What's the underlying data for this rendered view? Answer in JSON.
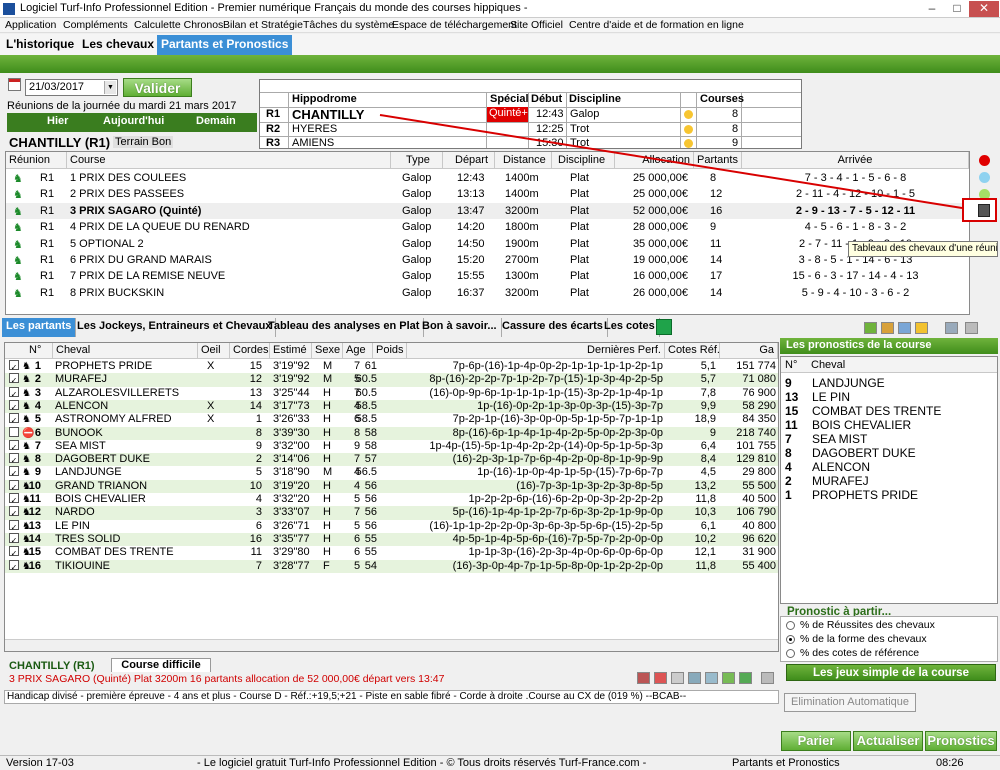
{
  "window": {
    "title": "Logiciel Turf-Info Professionnel Edition - Premier numérique Français du monde des courses hippiques -",
    "controls": [
      "–",
      "□",
      "✕"
    ]
  },
  "menu": [
    "Application",
    "Compléments",
    "Calculette Chronos",
    "Bilan et Stratégie",
    "Tâches du système",
    "Espace de téléchargement",
    "Site Officiel",
    "Centre d'aide et de formation en ligne"
  ],
  "tabs": [
    "L'historique",
    "Les chevaux",
    "Partants et Pronostics"
  ],
  "date": {
    "value": "21/03/2017",
    "valider": "Valider",
    "reunions_label": "Réunions de la journée du mardi 21 mars 2017",
    "nav": [
      "Hier",
      "Aujourd'hui",
      "Demain"
    ]
  },
  "course_header": {
    "title": "CHANTILLY (R1)",
    "terrain": "Terrain Bon"
  },
  "hippodromes": {
    "headers": [
      "Hippodrome",
      "Spécial",
      "Début",
      "Discipline",
      "Courses"
    ],
    "rows": [
      {
        "r": "R1",
        "name": "CHANTILLY",
        "special": "Quinté+",
        "debut": "12:43",
        "discipline": "Galop",
        "courses": "8"
      },
      {
        "r": "R2",
        "name": "HYERES",
        "special": "",
        "debut": "12:25",
        "discipline": "Trot",
        "courses": "8"
      },
      {
        "r": "R3",
        "name": "AMIENS",
        "special": "",
        "debut": "15:30",
        "discipline": "Trot",
        "courses": "9"
      }
    ]
  },
  "races": {
    "headers": [
      "Réunion",
      "Course",
      "Type",
      "Départ",
      "Distance",
      "Discipline",
      "Allocation",
      "Partants",
      "Arrivée"
    ],
    "rows": [
      {
        "r": "R1",
        "course": "1 PRIX DES COULEES",
        "type": "Galop",
        "depart": "12:43",
        "distance": "1400m",
        "discipline": "Plat",
        "allocation": "25 000,00€",
        "partants": "8",
        "arrivee": "7 - 3 - 4 - 1 - 5 - 6 - 8",
        "selected": false
      },
      {
        "r": "R1",
        "course": "2 PRIX DES PASSEES",
        "type": "Galop",
        "depart": "13:13",
        "distance": "1400m",
        "discipline": "Plat",
        "allocation": "25 000,00€",
        "partants": "12",
        "arrivee": "2 - 11 - 4 - 12 - 10 - 1 - 5",
        "selected": false
      },
      {
        "r": "R1",
        "course": "3 PRIX SAGARO (Quinté)",
        "type": "Galop",
        "depart": "13:47",
        "distance": "3200m",
        "discipline": "Plat",
        "allocation": "52 000,00€",
        "partants": "16",
        "arrivee": "2 - 9 - 13 - 7 - 5 - 12 - 11",
        "selected": true
      },
      {
        "r": "R1",
        "course": "4 PRIX DE LA QUEUE DU RENARD",
        "type": "Galop",
        "depart": "14:20",
        "distance": "1800m",
        "discipline": "Plat",
        "allocation": "28 000,00€",
        "partants": "9",
        "arrivee": "4 - 5 - 6 - 1 - 8 - 3 - 2",
        "selected": false
      },
      {
        "r": "R1",
        "course": "5 OPTIONAL 2",
        "type": "Galop",
        "depart": "14:50",
        "distance": "1900m",
        "discipline": "Plat",
        "allocation": "35 000,00€",
        "partants": "11",
        "arrivee": "2 - 7 - 11 - 1 - 9 - 3 - 10",
        "selected": false
      },
      {
        "r": "R1",
        "course": "6 PRIX DU GRAND MARAIS",
        "type": "Galop",
        "depart": "15:20",
        "distance": "2700m",
        "discipline": "Plat",
        "allocation": "19 000,00€",
        "partants": "14",
        "arrivee": "3 - 8 - 5 - 1 - 14 - 6 - 13",
        "selected": false
      },
      {
        "r": "R1",
        "course": "7 PRIX DE LA REMISE NEUVE",
        "type": "Galop",
        "depart": "15:55",
        "distance": "1300m",
        "discipline": "Plat",
        "allocation": "16 000,00€",
        "partants": "17",
        "arrivee": "15 - 6 - 3 - 17 - 14 - 4 - 13",
        "selected": false
      },
      {
        "r": "R1",
        "course": "8 PRIX BUCKSKIN",
        "type": "Galop",
        "depart": "16:37",
        "distance": "3200m",
        "discipline": "Plat",
        "allocation": "26 000,00€",
        "partants": "14",
        "arrivee": "5 - 9 - 4 - 10 - 3 - 6 - 2",
        "selected": false
      }
    ]
  },
  "tooltip": "Tableau des chevaux d'une réunion",
  "subtabs": [
    "Les partants",
    "Les Jockeys, Entraineurs et Chevaux",
    "Tableau des analyses en Plat",
    "Bon à savoir...",
    "Cassure des écarts",
    "Les cotes"
  ],
  "partants": {
    "headers": [
      "N°",
      "Cheval",
      "Oeil",
      "Cordes",
      "Estimé",
      "Sexe",
      "Age",
      "Poids",
      "Dernières Perf.",
      "Cotes Réf.",
      "Ga"
    ],
    "rows": [
      {
        "n": "1",
        "cheval": "PROPHETS PRIDE",
        "oeil": "X",
        "cordes": "15",
        "estime": "3'19\"92",
        "sexe": "M",
        "age": "7",
        "poids": "61",
        "perf": "7p-6p-(16)-1p-4p-0p-2p-1p-1p-1p-1p-2p-1p",
        "cote": "5,1",
        "gains": "151 774"
      },
      {
        "n": "2",
        "cheval": "MURAFEJ",
        "oeil": "",
        "cordes": "12",
        "estime": "3'19\"92",
        "sexe": "M",
        "age": "5",
        "poids": "60.5",
        "perf": "8p-(16)-2p-2p-7p-1p-2p-7p-(15)-1p-3p-4p-2p-5p",
        "cote": "5,7",
        "gains": "71 080"
      },
      {
        "n": "3",
        "cheval": "ALZAROLESVILLERETS",
        "oeil": "",
        "cordes": "13",
        "estime": "3'25\"44",
        "sexe": "H",
        "age": "7",
        "poids": "60.5",
        "perf": "(16)-0p-9p-6p-1p-1p-1p-1p-(15)-3p-2p-1p-4p-1p",
        "cote": "7,8",
        "gains": "76 900"
      },
      {
        "n": "4",
        "cheval": "ALENCON",
        "oeil": "X",
        "cordes": "14",
        "estime": "3'17\"73",
        "sexe": "H",
        "age": "4",
        "poids": "58.5",
        "perf": "1p-(16)-0p-2p-1p-3p-0p-3p-(15)-3p-7p",
        "cote": "9,9",
        "gains": "58 290"
      },
      {
        "n": "5",
        "cheval": "ASTRONOMY ALFRED",
        "oeil": "X",
        "cordes": "1",
        "estime": "3'26\"33",
        "sexe": "H",
        "age": "6",
        "poids": "58.5",
        "perf": "7p-2p-1p-(16)-3p-0p-0p-5p-1p-5p-7p-1p-1p",
        "cote": "18,9",
        "gains": "84 350"
      },
      {
        "n": "6",
        "cheval": "BUNOOK",
        "oeil": "",
        "cordes": "8",
        "estime": "3'39\"30",
        "sexe": "H",
        "age": "8",
        "poids": "58",
        "perf": "8p-(16)-6p-1p-4p-1p-4p-2p-5p-0p-2p-3p-0p",
        "cote": "9",
        "gains": "218 740",
        "nr": true
      },
      {
        "n": "7",
        "cheval": "SEA MIST",
        "oeil": "",
        "cordes": "9",
        "estime": "3'32\"00",
        "sexe": "H",
        "age": "9",
        "poids": "58",
        "perf": "1p-4p-(15)-5p-1p-4p-2p-2p-(14)-0p-5p-1p-5p-3p",
        "cote": "6,4",
        "gains": "101 755"
      },
      {
        "n": "8",
        "cheval": "DAGOBERT DUKE",
        "oeil": "",
        "cordes": "2",
        "estime": "3'14\"06",
        "sexe": "H",
        "age": "7",
        "poids": "57",
        "perf": "(16)-2p-3p-1p-7p-6p-4p-2p-0p-8p-1p-9p-9p",
        "cote": "8,4",
        "gains": "129 810"
      },
      {
        "n": "9",
        "cheval": "LANDJUNGE",
        "oeil": "",
        "cordes": "5",
        "estime": "3'18\"90",
        "sexe": "M",
        "age": "4",
        "poids": "56.5",
        "perf": "1p-(16)-1p-0p-4p-1p-5p-(15)-7p-6p-7p",
        "cote": "4,5",
        "gains": "29 800"
      },
      {
        "n": "10",
        "cheval": "GRAND TRIANON",
        "oeil": "",
        "cordes": "10",
        "estime": "3'19\"20",
        "sexe": "H",
        "age": "4",
        "poids": "56",
        "perf": "(16)-7p-3p-1p-3p-2p-3p-8p-5p",
        "cote": "13,2",
        "gains": "55 500"
      },
      {
        "n": "11",
        "cheval": "BOIS CHEVALIER",
        "oeil": "",
        "cordes": "4",
        "estime": "3'32\"20",
        "sexe": "H",
        "age": "5",
        "poids": "56",
        "perf": "1p-2p-2p-6p-(16)-6p-2p-0p-3p-2p-2p-2p",
        "cote": "11,8",
        "gains": "40 500"
      },
      {
        "n": "12",
        "cheval": "NARDO",
        "oeil": "",
        "cordes": "3",
        "estime": "3'33\"07",
        "sexe": "H",
        "age": "7",
        "poids": "56",
        "perf": "5p-(16)-1p-4p-1p-2p-7p-6p-3p-2p-1p-9p-0p",
        "cote": "10,3",
        "gains": "106 790"
      },
      {
        "n": "13",
        "cheval": "LE PIN",
        "oeil": "",
        "cordes": "6",
        "estime": "3'26\"71",
        "sexe": "H",
        "age": "5",
        "poids": "56",
        "perf": "(16)-1p-1p-2p-2p-0p-3p-6p-3p-5p-6p-(15)-2p-5p",
        "cote": "6,1",
        "gains": "40 800"
      },
      {
        "n": "14",
        "cheval": "TRES SOLID",
        "oeil": "",
        "cordes": "16",
        "estime": "3'35\"77",
        "sexe": "H",
        "age": "6",
        "poids": "55",
        "perf": "4p-5p-1p-4p-5p-6p-(16)-7p-5p-7p-2p-0p-0p",
        "cote": "10,2",
        "gains": "96 620"
      },
      {
        "n": "15",
        "cheval": "COMBAT DES TRENTE",
        "oeil": "",
        "cordes": "11",
        "estime": "3'29\"80",
        "sexe": "H",
        "age": "6",
        "poids": "55",
        "perf": "1p-1p-3p-(16)-2p-3p-4p-0p-6p-0p-6p-0p",
        "cote": "12,1",
        "gains": "31 900"
      },
      {
        "n": "16",
        "cheval": "TIKIOUINE",
        "oeil": "",
        "cordes": "7",
        "estime": "3'28\"77",
        "sexe": "F",
        "age": "5",
        "poids": "54",
        "perf": "(16)-3p-0p-4p-7p-1p-5p-8p-0p-1p-2p-2p-0p",
        "cote": "11,8",
        "gains": "55 400"
      }
    ]
  },
  "pronostics": {
    "title": "Les pronostics de la course",
    "headers": [
      "N°",
      "Cheval"
    ],
    "rows": [
      {
        "n": "9",
        "cheval": "LANDJUNGE"
      },
      {
        "n": "13",
        "cheval": "LE PIN"
      },
      {
        "n": "15",
        "cheval": "COMBAT DES TRENTE"
      },
      {
        "n": "11",
        "cheval": "BOIS CHEVALIER"
      },
      {
        "n": "7",
        "cheval": "SEA MIST"
      },
      {
        "n": "8",
        "cheval": "DAGOBERT DUKE"
      },
      {
        "n": "4",
        "cheval": "ALENCON"
      },
      {
        "n": "2",
        "cheval": "MURAFEJ"
      },
      {
        "n": "1",
        "cheval": "PROPHETS PRIDE"
      }
    ],
    "from_title": "Pronostic à partir...",
    "options": [
      "% de Réussites des chevaux",
      "% de la forme des chevaux",
      "% des cotes de référence"
    ],
    "selected_option": 1,
    "jeux_button": "Les jeux simple de la course",
    "elimination_button": "Elimination Automatique",
    "bottom_buttons": [
      "Parier",
      "Actualiser",
      "Pronostics"
    ]
  },
  "info": {
    "course": "CHANTILLY (R1)",
    "difficulty": "Course difficile",
    "summary": "3 PRIX SAGARO (Quinté) Plat 3200m 16 partants allocation de 52 000,00€ départ vers 13:47",
    "conditions": "Handicap divisé - première épreuve - 4 ans et plus - Course D - Réf.:+19,5;+21 - Piste en sable fibré - Corde à droite .Course au CX de (019 %)  --BCAB--"
  },
  "status": {
    "version": "Version 17-03",
    "copyright": "- Le logiciel gratuit Turf-Info Professionnel Edition - © Tous droits réservés Turf-France.com -",
    "section": "Partants et Pronostics",
    "time": "08:26"
  },
  "colors": {
    "green_dark": "#3a7d1f",
    "blue_tab": "#3b8fd6",
    "quinte_red": "#e00000",
    "annotation_red": "#d80000"
  }
}
